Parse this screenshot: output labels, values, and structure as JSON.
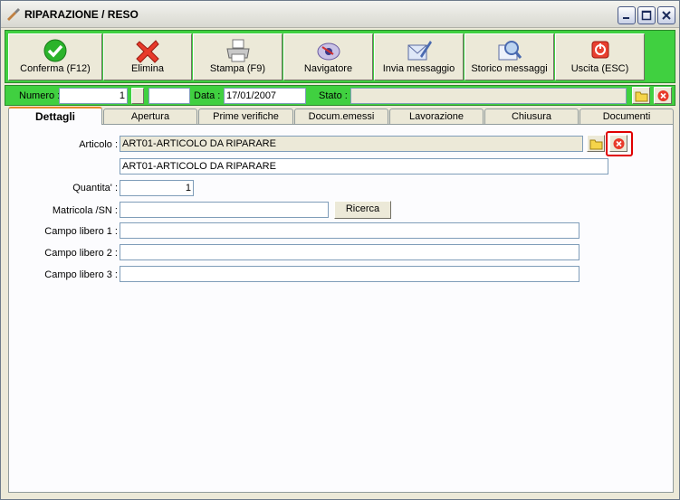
{
  "window": {
    "title": "RIPARAZIONE / RESO"
  },
  "toolbar": {
    "buttons": [
      {
        "label": "Conferma (F12)",
        "icon": "check-icon"
      },
      {
        "label": "Elimina",
        "icon": "delete-x-icon"
      },
      {
        "label": "Stampa (F9)",
        "icon": "printer-icon"
      },
      {
        "label": "Navigatore",
        "icon": "navigator-icon"
      },
      {
        "label": "Invia messaggio",
        "icon": "send-message-icon"
      },
      {
        "label": "Storico messaggi",
        "icon": "message-history-icon"
      },
      {
        "label": "Uscita (ESC)",
        "icon": "exit-icon"
      }
    ]
  },
  "header": {
    "numero_label": "Numero :",
    "numero_value": "1",
    "numero_suffix": "",
    "data_label": "Data :",
    "data_value": "17/01/2007",
    "stato_label": "Stato :",
    "stato_value": ""
  },
  "tabs": [
    {
      "label": "Dettagli",
      "active": true
    },
    {
      "label": "Apertura"
    },
    {
      "label": "Prime verifiche"
    },
    {
      "label": "Docum.emessi"
    },
    {
      "label": "Lavorazione"
    },
    {
      "label": "Chiusura"
    },
    {
      "label": "Documenti"
    }
  ],
  "details": {
    "articolo_label": "Articolo :",
    "articolo_code": "ART01-ARTICOLO DA RIPARARE",
    "articolo_description": "ART01-ARTICOLO DA RIPARARE",
    "quantita_label": "Quantita' :",
    "quantita_value": "1",
    "matricola_label": "Matricola /SN :",
    "matricola_value": "",
    "ricerca_label": "Ricerca",
    "campo1_label": "Campo libero 1 :",
    "campo1_value": "",
    "campo2_label": "Campo libero 2 :",
    "campo2_value": "",
    "campo3_label": "Campo libero 3 :",
    "campo3_value": ""
  },
  "colors": {
    "accent_green": "#40d040",
    "tab_highlight": "#e68b2c",
    "highlight_red": "#e00000"
  }
}
